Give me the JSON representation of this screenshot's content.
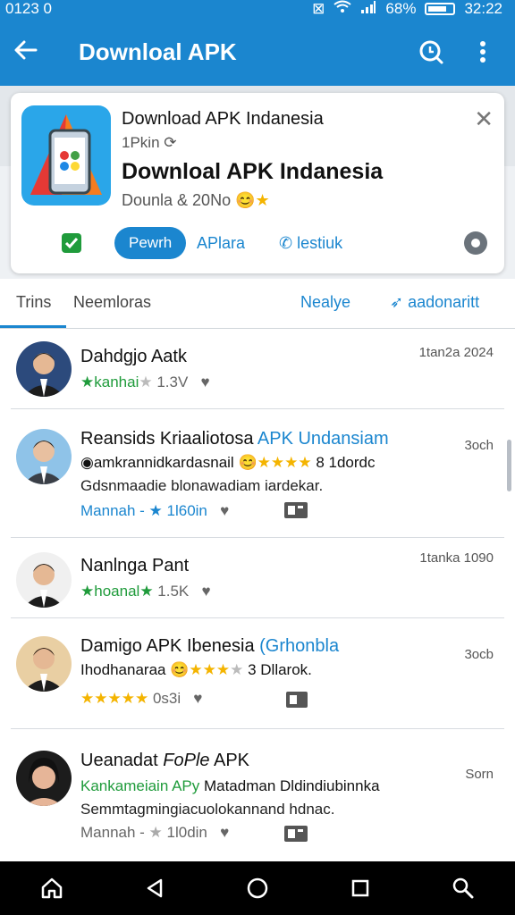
{
  "status_bar": {
    "time_left": "0123 0",
    "battery": "68%",
    "time_right": "32:22"
  },
  "app_bar": {
    "title": "Downloal APK"
  },
  "card": {
    "line1": "Download APK Indanesia",
    "line2": "1Pkin",
    "line3": "Downloal APK Indanesia",
    "line4": "Dounla & 20No",
    "actions": {
      "pill_label": "Pewrh",
      "second_label": "APlara",
      "third_label": "lestiuk"
    }
  },
  "tabs": {
    "tab1": "Trins",
    "tab2": "Neemloras",
    "tab3": "Nealye",
    "tab4": "aadonaritt"
  },
  "reviews": [
    {
      "title": "Dahdgjo Aatk",
      "time": "1tan2a 2024",
      "rating_label": "kanhai",
      "count": "1.3V"
    },
    {
      "title": "Reansids Kriaaliotosa ",
      "title_blue": "APK Undansiam",
      "time": "3och",
      "sub": "amkrannidkardasnail",
      "sub_tail": " 8 1dordc",
      "text": "Gdsnmaadie blonawadiam iardekar.",
      "meta_blue": "Mannah - ",
      "count": "1l60in"
    },
    {
      "title": "Nanlnga Pant",
      "time": "1tanka 1090",
      "rating_label": "hoanal",
      "count": "1.5K"
    },
    {
      "title": "Damigo APK Ibenesia ",
      "title_blue": "(Grhonbla",
      "time": "3ocb",
      "sub": "Ihodhanaraa",
      "sub_tail": " 3 Dllarok.",
      "count": "0s3i"
    },
    {
      "title": "Ueanadat ",
      "title_mid": "FoPle",
      "title_tail": " APK",
      "time": "Sorn",
      "sub_green": "Kankameiain APy",
      "sub_rest": " Matadman Dldindiubinnka",
      "text": "Semmtagmingiacuolokannand hdnac.",
      "meta": "Mannah - ",
      "count": "1l0din"
    }
  ]
}
